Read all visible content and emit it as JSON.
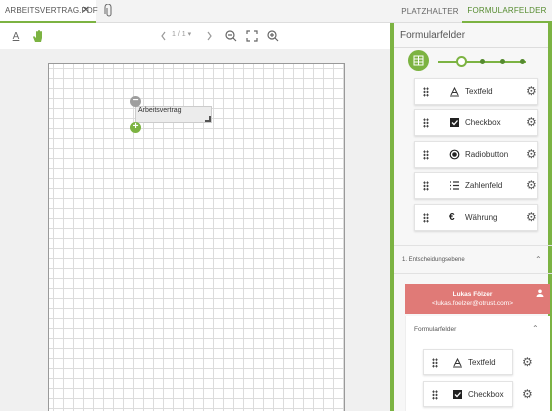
{
  "file_tab": {
    "name": "ARBEITSVERTRAG.PDF",
    "close": "✕"
  },
  "tabs": [
    {
      "label": "PLATZHALTER"
    },
    {
      "label": "FORMULARFELDER"
    }
  ],
  "toolbar": {
    "page_indicator": "1 / 1 ▾",
    "text_tool": "A"
  },
  "document": {
    "field_label": "Arbeitsvertrag"
  },
  "panel": {
    "title": "Formularfelder",
    "items": [
      {
        "label": "Textfeld",
        "icon": "text-field-icon"
      },
      {
        "label": "Checkbox",
        "icon": "checkbox-icon"
      },
      {
        "label": "Radiobutton",
        "icon": "radio-icon"
      },
      {
        "label": "Zahlenfeld",
        "icon": "number-list-icon"
      },
      {
        "label": "Währung",
        "icon": "euro-icon"
      }
    ],
    "decision_level": "1. Entscheidungsebene",
    "user": {
      "name": "Lukas Fölzer",
      "email": "<lukas.foelzer@otrust.com>"
    },
    "sub_title": "Formularfelder",
    "sub_items": [
      {
        "label": "Textfeld",
        "icon": "text-field-icon"
      },
      {
        "label": "Checkbox",
        "icon": "checkbox-icon"
      }
    ]
  },
  "colors": {
    "accent": "#7cb342",
    "accent_dark": "#558b2f",
    "user_card": "#e07a77"
  }
}
